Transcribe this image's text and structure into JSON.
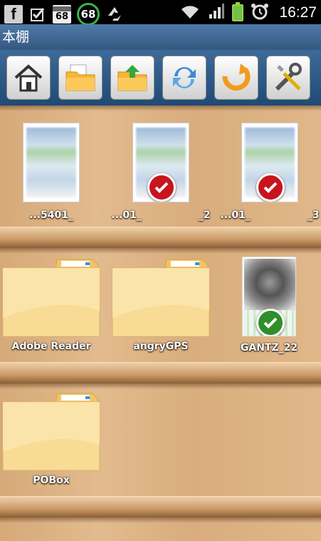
{
  "status_bar": {
    "calendar_day": "68",
    "badge_count": "68",
    "time": "16:27",
    "icons": [
      "facebook-icon",
      "checkbox-icon",
      "calendar-icon",
      "count-ring-icon",
      "recycle-icon",
      "wifi-icon",
      "signal-icon",
      "battery-icon",
      "alarm-icon"
    ]
  },
  "title": "本棚",
  "toolbar": {
    "buttons": [
      "home-icon",
      "open-folder-icon",
      "upload-folder-icon",
      "refresh-icon",
      "back-arrow-icon",
      "settings-tools-icon"
    ]
  },
  "shelf1": [
    {
      "label": "...5401_",
      "checked": false
    },
    {
      "label": "...01_",
      "label_suffix": "_2",
      "checked": true
    },
    {
      "label": "...01_",
      "label_suffix": "_3",
      "checked": true
    }
  ],
  "shelf2": [
    {
      "label": "Adobe Reader",
      "type": "folder"
    },
    {
      "label": "angryGPS",
      "type": "folder"
    },
    {
      "label": "GANTZ_22",
      "type": "book",
      "checked": true
    }
  ],
  "shelf3": [
    {
      "label": "POBox",
      "type": "folder"
    }
  ],
  "colors": {
    "title_bar": "#3f6893",
    "check_red": "#c8141d",
    "check_green": "#2f8f2b",
    "battery": "#76c043",
    "badge_ring": "#3cb34a"
  }
}
